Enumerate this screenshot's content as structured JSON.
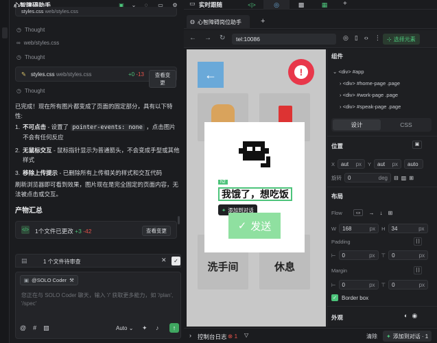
{
  "app": {
    "title": "心智障碍助手"
  },
  "topbar": {
    "realtime_label": "实时跟随"
  },
  "chat": {
    "thought1": "Thought",
    "file1_name": "web/styles.css",
    "thought2": "Thought",
    "edit": {
      "file": "styles.css",
      "path": "web/styles.css",
      "added": "+0",
      "removed": "-13",
      "view": "查看变更"
    },
    "thought3": "Thought",
    "intro": "已完成！现在所有图片都变成了页面的固定部分，具有以下特性:",
    "items": [
      {
        "num": "1.",
        "bold": "不可点击",
        "pre": " - 设置了 ",
        "code": "pointer-events: none",
        "post": " ，点击图片不会有任何反应"
      },
      {
        "num": "2.",
        "bold": "无鼠标交互",
        "pre": " - 鼠标指针显示为普通箭头，不会变成手型或其他样式",
        "code": "",
        "post": ""
      },
      {
        "num": "3.",
        "bold": "移除上传提示",
        "pre": " - 已删除所有上传相关的样式和交互代码",
        "code": "",
        "post": ""
      }
    ],
    "outro": "刷新浏览器即可看到效果，图片现在是完全固定的页面内容，无法被点击或交互。",
    "summary_title": "产物汇总",
    "summary": {
      "label": "1个文件已更改",
      "added": "+3",
      "removed": "-42",
      "view": "查看变更"
    },
    "pending": "1 个文件待审查",
    "composer": {
      "agent": "@SOLO Coder",
      "placeholder": "您正在与 SOLO Coder 聊天，输入 '/' 获取更多能力，如 '/plan', '/spec'",
      "model": "Auto"
    }
  },
  "browser": {
    "tab_label": "心智障碍岗位助手",
    "url": "tel:10086",
    "select_label": "选择元素"
  },
  "preview": {
    "tag_badge": "h2",
    "heading": "我饿了，想吃饭",
    "add_to_chat": "添加到对话",
    "send": "发送",
    "tile_left": "洗手间",
    "tile_right": "休息",
    "colors": {
      "accent_red": "#e8374a",
      "send_green": "#8fe0a0",
      "back_blue": "#6aa9d9"
    }
  },
  "inspector": {
    "components_title": "组件",
    "tree": [
      "<div> #app",
      "<div> #home-page .page",
      "<div> #work-page .page",
      "<div> #speak-page .page"
    ],
    "tab_design": "设计",
    "tab_css": "CSS",
    "position_title": "位置",
    "x_label": "X",
    "x_value": "aut",
    "x_unit": "px",
    "y_label": "Y",
    "y_value": "aut",
    "y_unit": "px",
    "z_value": "auto",
    "rotate_label": "旋转",
    "rotate_value": "0",
    "rotate_unit": "deg",
    "layout_title": "布局",
    "flow_label": "Flow",
    "w_label": "W",
    "w_value": "168",
    "w_unit": "px",
    "h_label": "H",
    "h_value": "34",
    "h_unit": "px",
    "padding_label": "Padding",
    "pad_h": "0",
    "pad_v": "0",
    "pad_unit": "px",
    "margin_label": "Margin",
    "mar_h": "0",
    "mar_v": "0",
    "mar_unit": "px",
    "border_box": "Border box",
    "appearance_title": "外观"
  },
  "bottom": {
    "console": "控制台日志",
    "errors": "1",
    "clear": "清除",
    "add_chat": "添加到对话 · 1"
  }
}
